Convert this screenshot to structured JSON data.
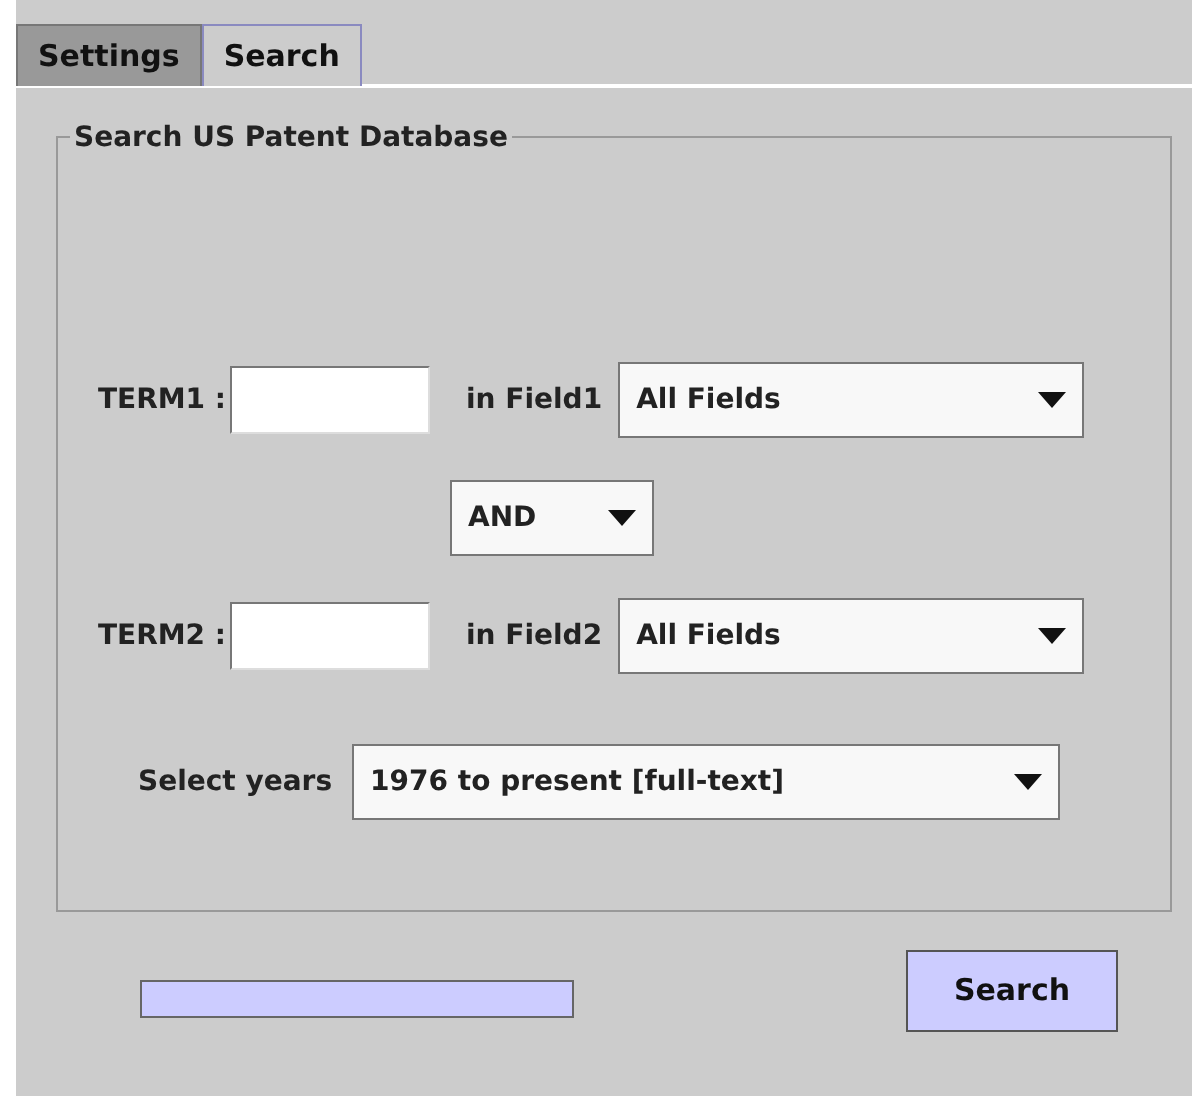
{
  "tabs": [
    {
      "label": "Settings",
      "selected": false
    },
    {
      "label": "Search",
      "selected": true
    }
  ],
  "group": {
    "title": "Search US Patent Database",
    "term1": {
      "label": "TERM1 :",
      "field_label": "in Field1",
      "field_value": "All Fields"
    },
    "operator": {
      "value": "AND"
    },
    "term2": {
      "label": "TERM2 :",
      "field_label": "in Field2",
      "field_value": "All Fields"
    },
    "years": {
      "label": "Select years",
      "value": "1976 to present [full-text]"
    }
  },
  "progress": {
    "level": 1
  },
  "search_button": {
    "label": "Search"
  }
}
